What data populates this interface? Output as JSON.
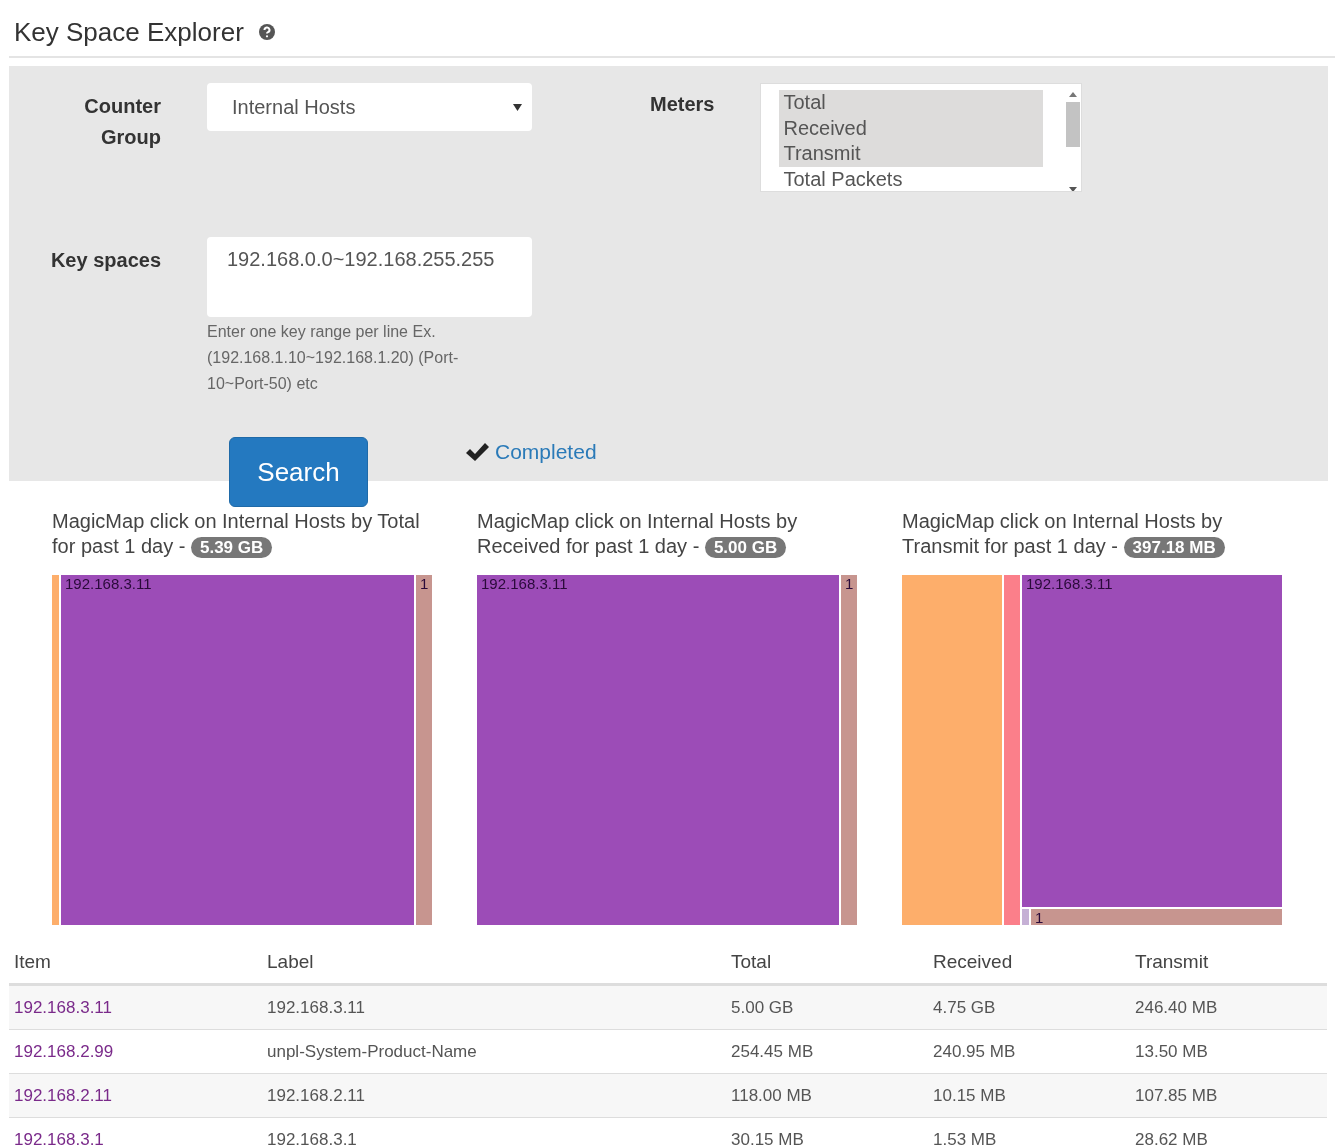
{
  "header": {
    "title": "Key Space Explorer"
  },
  "form": {
    "counter_group": {
      "label": "Counter Group",
      "value": "Internal Hosts"
    },
    "key_spaces": {
      "label": "Key spaces",
      "value": "192.168.0.0~192.168.255.255",
      "help": "Enter one key range per line Ex. (192.168.1.10~192.168.1.20) (Port-10~Port-50) etc"
    },
    "meters": {
      "label": "Meters",
      "options": [
        {
          "label": "Total",
          "selected": true
        },
        {
          "label": "Received",
          "selected": true
        },
        {
          "label": "Transmit",
          "selected": true
        },
        {
          "label": "Total Packets",
          "selected": false
        }
      ]
    },
    "search_button": "Search",
    "status": "Completed"
  },
  "maps": [
    {
      "title": "MagicMap click on Internal Hosts by Total for past 1 day -",
      "badge": "5.39 GB",
      "cells": [
        {
          "kind": "thin",
          "color": "#fdae6b"
        },
        {
          "kind": "large",
          "color": "#9c4cb7",
          "label": "192.168.3.11"
        },
        {
          "kind": "narrow",
          "color": "#c7958f",
          "label": "1"
        }
      ]
    },
    {
      "title": "MagicMap click on Internal Hosts by Received for past 1 day -",
      "badge": "5.00 GB",
      "cells": [
        {
          "kind": "large",
          "color": "#9c4cb7",
          "label": "192.168.3.11"
        },
        {
          "kind": "narrow",
          "color": "#c7958f",
          "label": "1"
        }
      ]
    },
    {
      "title": "MagicMap click on Internal Hosts by Transmit for past 1 day -",
      "badge": "397.18 MB",
      "cells": [
        {
          "kind": "medium",
          "color": "#fdae6b"
        },
        {
          "kind": "narrow",
          "color": "#fb7f8a"
        },
        {
          "kind": "large",
          "children": [
            {
              "kind": "large",
              "color": "#9c4cb7",
              "label": "192.168.3.11"
            },
            {
              "kind": "narrow",
              "children": [
                {
                  "kind": "thin",
                  "color": "#c5b0d5"
                },
                {
                  "kind": "large",
                  "color": "#c7958f",
                  "label": "1"
                }
              ]
            }
          ]
        }
      ]
    }
  ],
  "table": {
    "columns": [
      "Item",
      "Label",
      "Total",
      "Received",
      "Transmit"
    ],
    "rows": [
      [
        "192.168.3.11",
        "192.168.3.11",
        "5.00 GB",
        "4.75 GB",
        "246.40 MB"
      ],
      [
        "192.168.2.99",
        "unpl-System-Product-Name",
        "254.45 MB",
        "240.95 MB",
        "13.50 MB"
      ],
      [
        "192.168.2.11",
        "192.168.2.11",
        "118.00 MB",
        "10.15 MB",
        "107.85 MB"
      ],
      [
        "192.168.3.1",
        "192.168.3.1",
        "30.15 MB",
        "1.53 MB",
        "28.62 MB"
      ]
    ]
  }
}
